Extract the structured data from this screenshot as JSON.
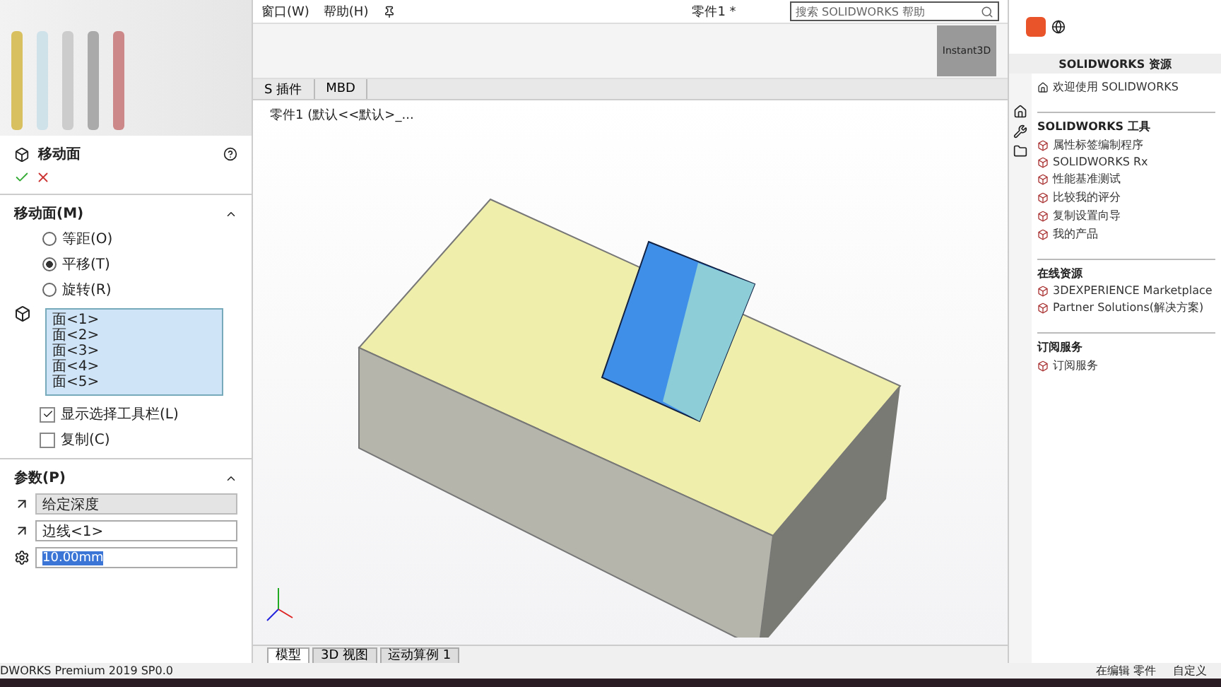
{
  "menu": [
    {
      "label": "窗口(W)"
    },
    {
      "label": "帮助(H)"
    }
  ],
  "document_title": "零件1 *",
  "search": {
    "placeholder": "搜索 SOLIDWORKS 帮助"
  },
  "ribbon": {
    "buttons": [
      {
        "label": "Instant3D",
        "selected": true
      }
    ]
  },
  "command_tabs": [
    {
      "label": "S 插件",
      "selected": false
    },
    {
      "label": "MBD",
      "selected": false
    }
  ],
  "viewport": {
    "part_label": "零件1 (默认<<默认>_..."
  },
  "property_manager": {
    "title": "移动面",
    "move_section": {
      "title": "移动面(M)",
      "options": [
        {
          "label": "等距(O)",
          "selected": false
        },
        {
          "label": "平移(T)",
          "selected": true
        },
        {
          "label": "旋转(R)",
          "selected": false
        }
      ],
      "faces": [
        "面<1>",
        "面<2>",
        "面<3>",
        "面<4>",
        "面<5>"
      ]
    },
    "checkboxes": [
      {
        "label": "显示选择工具栏(L)",
        "checked": true
      },
      {
        "label": "复制(C)",
        "checked": false
      }
    ],
    "parameters": {
      "title": "参数(P)",
      "end_condition": "给定深度",
      "edge": "边线<1>",
      "distance": "10.00mm",
      "distance_highlighted": true
    }
  },
  "task_pane": {
    "title": "SOLIDWORKS 资源",
    "welcome": "欢迎使用 SOLIDWORKS",
    "groups": [
      {
        "title": "SOLIDWORKS 工具",
        "items": [
          "属性标签编制程序",
          "SOLIDWORKS Rx",
          "性能基准测试",
          "比较我的评分",
          "复制设置向导",
          "我的产品"
        ]
      },
      {
        "title": "在线资源",
        "items": [
          "3DEXPERIENCE Marketplace",
          "Partner Solutions(解决方案)"
        ]
      },
      {
        "title": "订阅服务",
        "items": [
          "订阅服务"
        ]
      }
    ]
  },
  "bottom_tabs": [
    {
      "label": "模型",
      "selected": true
    },
    {
      "label": "3D 视图",
      "selected": false
    },
    {
      "label": "运动算例 1",
      "selected": false
    }
  ],
  "status_bar": {
    "product": "DWORKS Premium 2019 SP0.0",
    "mode": "在编辑 零件",
    "custom": "自定义"
  }
}
